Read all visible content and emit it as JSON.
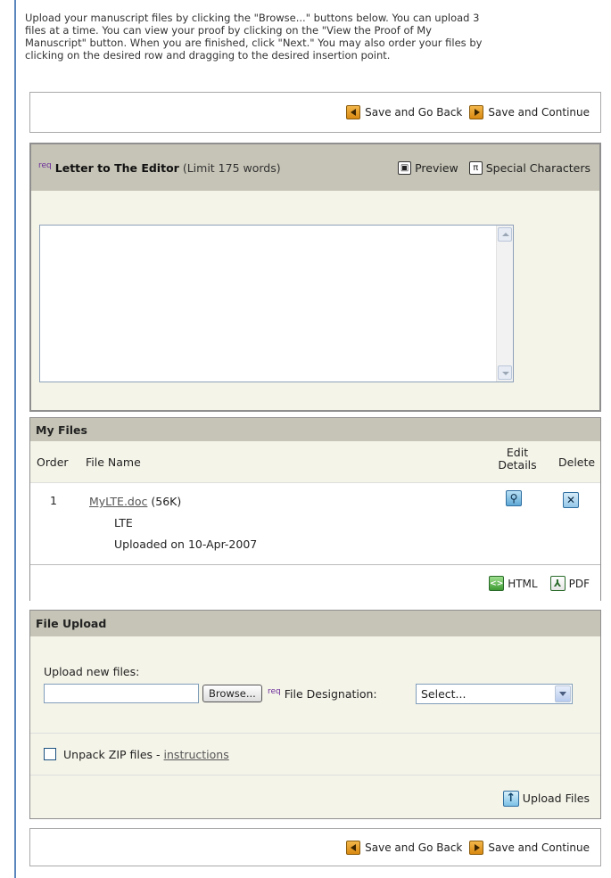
{
  "intro_text": "Upload your manuscript files by clicking the \"Browse...\" buttons below. You can upload 3\nfiles at a time. You can view your proof by clicking on the \"View the Proof of My\nManuscript\" button. When you are finished, click \"Next.\" You may also order your files by\nclicking on the desired row and dragging to the desired insertion point.",
  "nav": {
    "back_label": "Save and Go Back",
    "continue_label": "Save and Continue"
  },
  "editor": {
    "req_marker": "req",
    "title": "Letter to The Editor",
    "limit": "(Limit 175 words)",
    "preview_label": "Preview",
    "special_chars_label": "Special Characters",
    "special_chars_glyph": "π"
  },
  "files": {
    "header": "My Files",
    "columns": {
      "order": "Order",
      "file_name": "File Name",
      "edit_details": "Edit\nDetails",
      "delete": "Delete"
    },
    "rows": [
      {
        "order": "1",
        "file_link": "MyLTE.doc",
        "size": "(56K)",
        "designation": "LTE",
        "uploaded": "Uploaded on 10-Apr-2007"
      }
    ],
    "html_label": "HTML",
    "pdf_label": "PDF"
  },
  "upload": {
    "header": "File Upload",
    "new_files_label": "Upload new files:",
    "browse_label": "Browse...",
    "req_marker": "req",
    "designation_label": "File Designation:",
    "designation_selected": "Select...",
    "unpack_label": "Unpack ZIP files - ",
    "instructions_link": "instructions",
    "upload_button_label": "Upload Files"
  },
  "colors": {
    "frame": "#5b86bd",
    "header_bg": "#c6c4b6",
    "panel_bg": "#f5f4e9",
    "req": "#6a2b99"
  },
  "icons": [
    "save-back-arrow-icon",
    "save-continue-arrow-icon",
    "preview-icon",
    "pi-icon",
    "edit-details-magnifier-icon",
    "delete-x-icon",
    "html-icon",
    "pdf-icon",
    "upload-arrow-icon",
    "select-dropdown-arrow-icon"
  ]
}
